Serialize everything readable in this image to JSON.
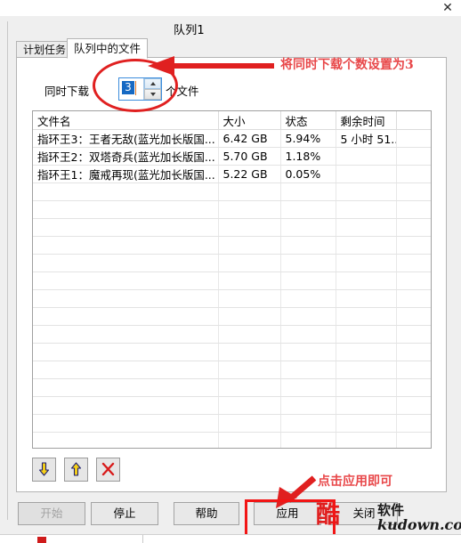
{
  "window": {
    "close_icon": "close-icon"
  },
  "dialog": {
    "title": "队列1"
  },
  "tabs": [
    {
      "label": "计划任务",
      "active": false
    },
    {
      "label": "队列中的文件",
      "active": true
    }
  ],
  "spinner": {
    "label_before": "同时下载",
    "value": "3",
    "label_after": "个文件",
    "up_icon": "chevron-up-icon",
    "down_icon": "chevron-down-icon"
  },
  "table": {
    "columns": [
      "文件名",
      "大小",
      "状态",
      "剩余时间",
      ""
    ],
    "rows": [
      {
        "name": "指环王3：王者无敌(蓝光加长版国...",
        "size": "6.42  GB",
        "state": "5.94%",
        "time": "5 小时 51...",
        "pad": ""
      },
      {
        "name": "指环王2：双塔奇兵(蓝光加长版国...",
        "size": "5.70  GB",
        "state": "1.18%",
        "time": "",
        "pad": ""
      },
      {
        "name": "指环王1：魔戒再现(蓝光加长版国...",
        "size": "5.22  GB",
        "state": "0.05%",
        "time": "",
        "pad": ""
      }
    ],
    "empty_row_count": 18
  },
  "icon_buttons": [
    {
      "name": "move-down-button",
      "icon": "arrow-down-icon",
      "color": "#f2c200"
    },
    {
      "name": "move-up-button",
      "icon": "arrow-up-icon",
      "color": "#f2c200"
    },
    {
      "name": "delete-button",
      "icon": "red-x-icon",
      "color": "#d81b1b"
    }
  ],
  "buttons": {
    "start": "开始",
    "stop": "停止",
    "help": "帮助",
    "apply": "应用",
    "close": "关闭"
  },
  "annotations": {
    "top_text": "将同时下载个数设置为3",
    "bottom_text": "点击应用即可",
    "highlight_color": "#e02020"
  },
  "watermark": {
    "logo": "酷",
    "line1": "软件",
    "line2": "kudown.com"
  }
}
